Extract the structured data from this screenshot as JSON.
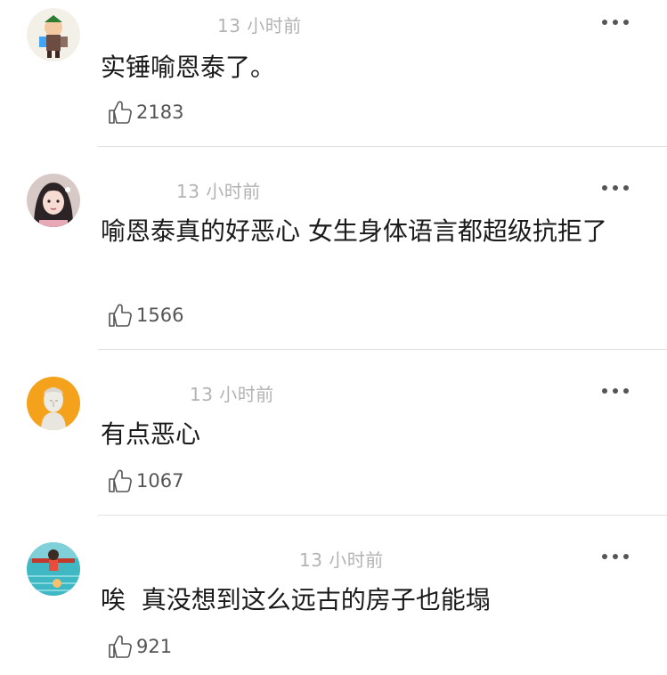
{
  "comments": [
    {
      "time": "13 小时前",
      "text": "实锤喻恩泰了。",
      "likes": "2183",
      "avatar_icon": "cartoon-character-avatar",
      "avatar_bg": "#f3f0e8"
    },
    {
      "time": "13 小时前",
      "text": "喻恩泰真的好恶心 女生身体语言都超级抗拒了",
      "likes": "1566",
      "avatar_icon": "girl-photo-avatar",
      "avatar_bg": "#d7c9c6"
    },
    {
      "time": "13 小时前",
      "text": "有点恶心",
      "likes": "1067",
      "avatar_icon": "statue-bust-avatar",
      "avatar_bg": "#f4a21c"
    },
    {
      "time": "13 小时前",
      "text": "唉  真没想到这么远古的房子也能塌",
      "likes": "921",
      "avatar_icon": "pool-scene-avatar",
      "avatar_bg": "#3fb8c4"
    }
  ],
  "colors": {
    "timestamp": "#b3b3b3",
    "divider": "#e2e2e2",
    "text": "#1a1a1a"
  }
}
